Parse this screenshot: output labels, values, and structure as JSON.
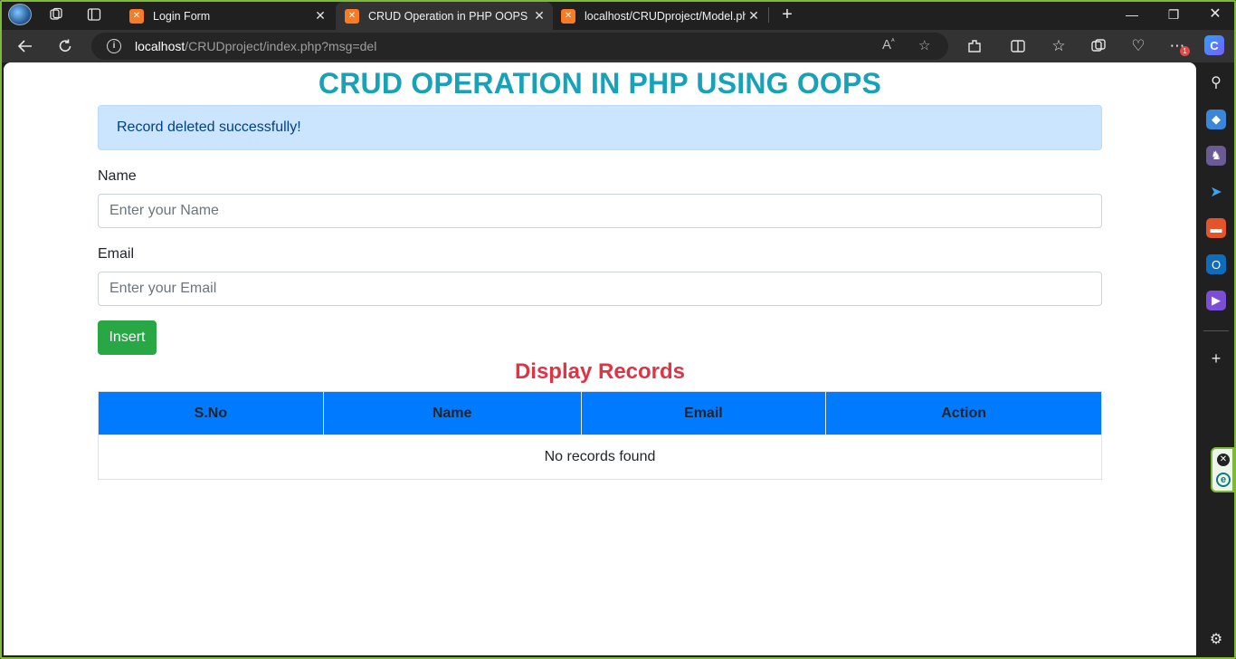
{
  "browser": {
    "tabs": [
      {
        "label": "Login Form"
      },
      {
        "label": "CRUD Operation in PHP OOPS"
      },
      {
        "label": "localhost/CRUDproject/Model.ph"
      }
    ],
    "address": {
      "host": "localhost",
      "path": "/CRUDproject/index.php?msg=del"
    },
    "notification_count": "1"
  },
  "page": {
    "title": "CRUD OPERATION IN PHP USING OOPS",
    "alert": "Record deleted successfully!",
    "name_label": "Name",
    "name_placeholder": "Enter your Name",
    "email_label": "Email",
    "email_placeholder": "Enter your Email",
    "insert_label": "Insert",
    "records_title": "Display Records",
    "table": {
      "headers": [
        "S.No",
        "Name",
        "Email",
        "Action"
      ],
      "empty_message": "No records found"
    }
  },
  "colors": {
    "title": "#17a2b8",
    "alert_bg": "#cce5ff",
    "insert_button": "#28a745",
    "records_title": "#dc3545",
    "table_header": "#007bff"
  }
}
